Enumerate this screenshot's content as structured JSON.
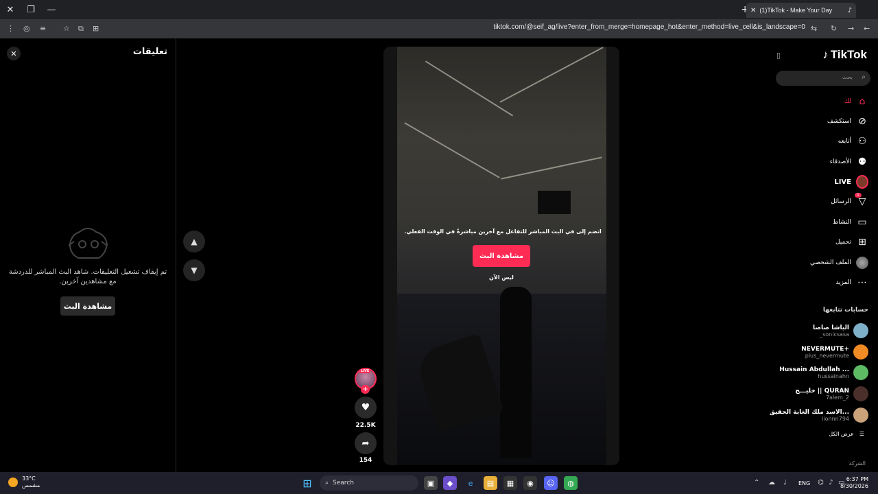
{
  "browser": {
    "tab_title": "(1)TikTok - Make Your Day",
    "url": "tiktok.com/@seif_ag/live?enter_from_merge=homepage_hot&enter_method=live_cell&is_landscape=0"
  },
  "comments": {
    "title": "تعليقات",
    "empty_message": "تم إيقاف تشغيل التعليقات. شاهد البث المباشر للدردشة مع مشاهدين آخرين.",
    "watch_button": "مشاهدة البث"
  },
  "video": {
    "overlay_message": "انضم إلى في البث المباشر للتفاعل مع آخرين مباشرةً في الوقت الفعلي.",
    "watch_button": "مشاهدة البث",
    "not_now": "ليس الآن"
  },
  "actions": {
    "live_badge": "LIVE",
    "likes": "22.5K",
    "shares": "154"
  },
  "sidebar": {
    "logo_text": "TikTok",
    "search_placeholder": "بحث",
    "nav": [
      {
        "label": "لك",
        "icon": "home-icon",
        "active": true
      },
      {
        "label": "استكشف",
        "icon": "compass-icon"
      },
      {
        "label": "أتابعه",
        "icon": "user-follow-icon"
      },
      {
        "label": "الأصدقاء",
        "icon": "friends-icon"
      },
      {
        "label": "LIVE",
        "icon": "live-icon"
      },
      {
        "label": "الرسائل",
        "icon": "send-icon",
        "badge": "1"
      },
      {
        "label": "النشاط",
        "icon": "message-icon"
      },
      {
        "label": "تحميل",
        "icon": "upload-icon"
      },
      {
        "label": "الملف الشخصي",
        "icon": "profile-avatar-icon"
      },
      {
        "label": "المزيد",
        "icon": "more-icon"
      }
    ],
    "following_title": "حسابات تتابعها",
    "accounts": [
      {
        "name": "الباشا صاصا",
        "handle": "_sonicsasa",
        "color": "#7fb0c9"
      },
      {
        "name": "NEVERMUTE+",
        "handle": "plus_nevermute",
        "color": "#f08a24"
      },
      {
        "name": "Hussain Abdullah ...",
        "handle": "hussainahn",
        "color": "#5dbb63"
      },
      {
        "name": "خليـــج || QURAN",
        "handle": "7alem_2",
        "color": "#4a2f2a"
      },
      {
        "name": "الاسد ملك الغابة الحقيق...",
        "handle": "lionnn794",
        "color": "#c9a27a"
      }
    ],
    "see_all": "عرض الكل",
    "company": "الشركة"
  },
  "taskbar": {
    "temp": "33°C",
    "weather": "مشمس",
    "search": "Search",
    "lang": "ENG",
    "time": "6:37 PM",
    "date": "8/30/2026"
  },
  "colors": {
    "accent": "#fe2c55",
    "panel": "#000000"
  }
}
